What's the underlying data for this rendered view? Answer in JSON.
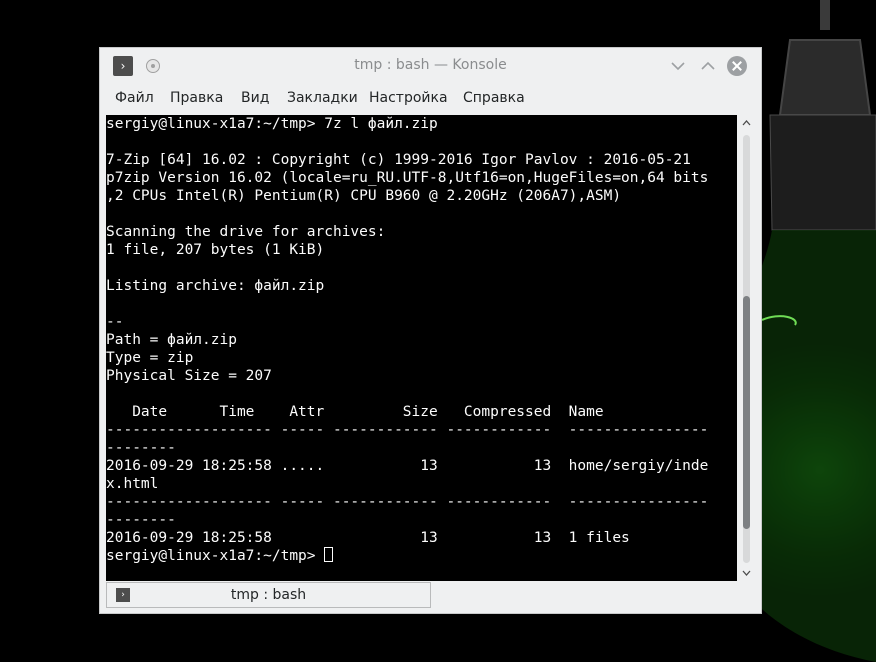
{
  "window": {
    "title": "tmp : bash — Konsole"
  },
  "menu": [
    "Файл",
    "Правка",
    "Вид",
    "Закладки",
    "Настройка",
    "Справка"
  ],
  "terminal": {
    "lines": [
      "sergiy@linux-x1a7:~/tmp> 7z l файл.zip",
      "",
      "7-Zip [64] 16.02 : Copyright (c) 1999-2016 Igor Pavlov : 2016-05-21",
      "p7zip Version 16.02 (locale=ru_RU.UTF-8,Utf16=on,HugeFiles=on,64 bits",
      ",2 CPUs Intel(R) Pentium(R) CPU B960 @ 2.20GHz (206A7),ASM)",
      "",
      "Scanning the drive for archives:",
      "1 file, 207 bytes (1 KiB)",
      "",
      "Listing archive: файл.zip",
      "",
      "--",
      "Path = файл.zip",
      "Type = zip",
      "Physical Size = 207",
      "",
      "   Date      Time    Attr         Size   Compressed  Name",
      "------------------- ----- ------------ ------------  ----------------",
      "--------",
      "2016-09-29 18:25:58 .....           13           13  home/sergiy/inde",
      "x.html",
      "------------------- ----- ------------ ------------  ----------------",
      "--------",
      "2016-09-29 18:25:58                 13           13  1 files"
    ],
    "prompt": "sergiy@linux-x1a7:~/tmp> "
  },
  "tab": {
    "label": "tmp : bash"
  },
  "colors": {
    "accent_green": "#1fa31a",
    "terminal_bg": "#000000",
    "terminal_fg": "#fcfcfc"
  }
}
